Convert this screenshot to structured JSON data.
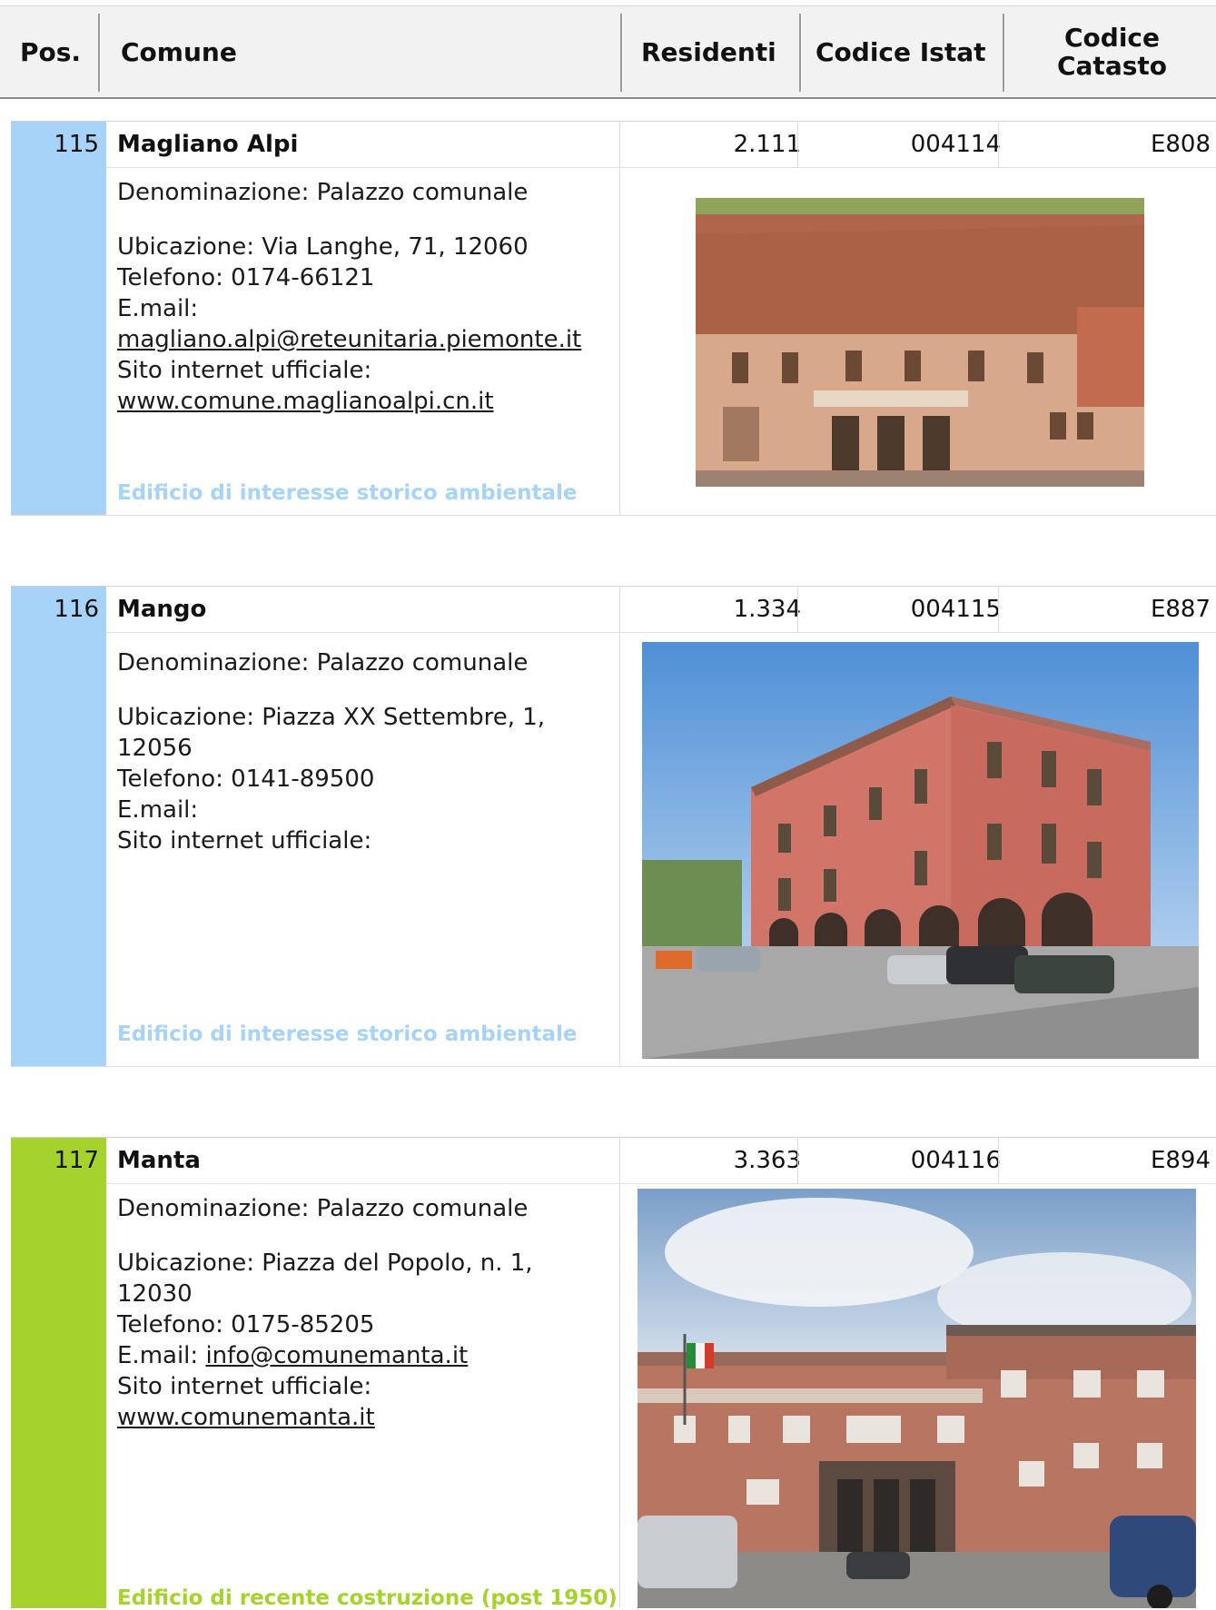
{
  "header": {
    "pos": "Pos.",
    "comune": "Comune",
    "residenti": "Residenti",
    "codice_istat": "Codice Istat",
    "codice_catasto_1": "Codice",
    "codice_catasto_2": "Catasto"
  },
  "colors": {
    "storico": "#a6d3f7",
    "recente": "#a5d22c"
  },
  "entries": [
    {
      "pos": "115",
      "comune": "Magliano Alpi",
      "residenti": "2.111",
      "istat": "004114",
      "catasto": "E808",
      "denominazione": "Denominazione: Palazzo comunale",
      "ubicazione": "Ubicazione: Via Langhe, 71, 12060",
      "telefono": "Telefono: 0174-66121",
      "email_label": "E.mail:",
      "email": "magliano.alpi@reteunitaria.piemonte.it",
      "sito_label": "Sito internet ufficiale:",
      "sito": "www.comune.maglianoalpi.cn.it",
      "categoria": "Edificio di interesse storico ambientale"
    },
    {
      "pos": "116",
      "comune": "Mango",
      "residenti": "1.334",
      "istat": "004115",
      "catasto": "E887",
      "denominazione": "Denominazione: Palazzo comunale",
      "ubicazione_1": "Ubicazione: Piazza XX Settembre, 1,",
      "ubicazione_2": "12056",
      "telefono": "Telefono: 0141-89500",
      "email_label": "E.mail:",
      "sito_label": "Sito internet ufficiale:",
      "categoria": "Edificio di interesse storico ambientale"
    },
    {
      "pos": "117",
      "comune": "Manta",
      "residenti": "3.363",
      "istat": "004116",
      "catasto": "E894",
      "denominazione": "Denominazione: Palazzo comunale",
      "ubicazione_1": "Ubicazione: Piazza del Popolo, n. 1,",
      "ubicazione_2": "12030",
      "telefono": "Telefono: 0175-85205",
      "email_label": "E.mail: ",
      "email": "info@comunemanta.it",
      "sito_label": "Sito internet ufficiale:",
      "sito": "www.comunemanta.it",
      "categoria": "Edificio di recente costruzione (post 1950)"
    }
  ]
}
